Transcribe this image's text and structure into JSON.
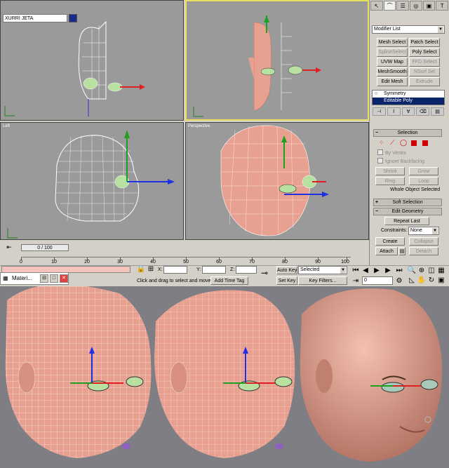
{
  "command_panel": {
    "object_name": "XURRI JETA",
    "object_color": "#1a2a8a",
    "modifier_list": "Modifier List",
    "buttons": [
      "Mesh Select",
      "Patch Select",
      "SplineSelect",
      "Poly Select",
      "UVW Map",
      "FFD Select",
      "MeshSmooth",
      "NSurf Sel",
      "Edit Mesh",
      "Extrude"
    ],
    "stack": [
      "Symmetry",
      "Editable Poly"
    ],
    "selection": {
      "title": "Selection",
      "by_vertex": "By Vertex",
      "ignore_backfacing": "Ignore Backfacing",
      "shrink": "Shrink",
      "grow": "Grow",
      "ring": "Ring",
      "loop": "Loop",
      "status": "Whole Object Selected"
    },
    "soft_selection": "Soft Selection",
    "edit_geometry": {
      "title": "Edit Geometry",
      "repeat_last": "Repeat Last",
      "constraints_label": "Constraints:",
      "constraints_value": "None",
      "create": "Create",
      "collapse": "Collapse",
      "attach": "Attach",
      "detach": "Detach"
    }
  },
  "timeline": {
    "slider": "0 / 100",
    "ticks": [
      "0",
      "10",
      "20",
      "30",
      "40",
      "50",
      "60",
      "70",
      "80",
      "90",
      "100"
    ]
  },
  "status": {
    "x_label": "X:",
    "y_label": "Y:",
    "z_label": "Z:",
    "prompt": "Click and drag to select and move",
    "add_time_tag": "Add Time Tag",
    "auto_key": "Auto Key",
    "auto_key_value": "Selected",
    "set_key": "Set Key",
    "key_filters": "Key Filters...",
    "frame": "0"
  },
  "material_editor": {
    "title": "Materi..."
  },
  "colors": {
    "skin": "#e8a090",
    "wire": "#ffffff",
    "active_border": "#e8e060"
  }
}
